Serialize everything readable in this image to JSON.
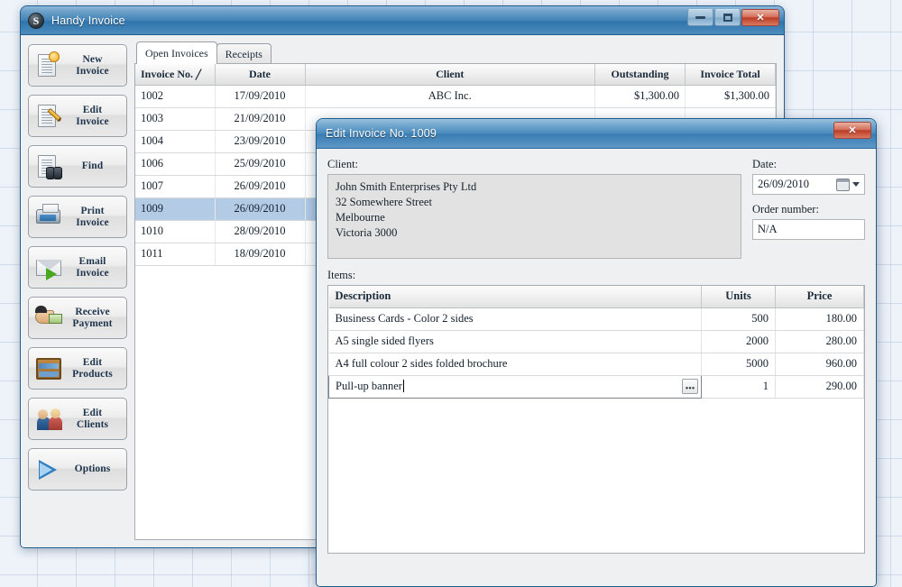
{
  "main_window": {
    "title": "Handy Invoice",
    "app_icon": "handy-invoice-logo-icon",
    "buttons": {
      "minimize": "–",
      "maximize": "□",
      "close": "✕"
    },
    "sidebar": [
      {
        "label_line1": "New",
        "label_line2": "Invoice",
        "icon": "new-invoice-icon"
      },
      {
        "label_line1": "Edit",
        "label_line2": "Invoice",
        "icon": "edit-invoice-icon"
      },
      {
        "label_line1": "Find",
        "label_line2": "",
        "icon": "find-icon"
      },
      {
        "label_line1": "Print",
        "label_line2": "Invoice",
        "icon": "print-invoice-icon"
      },
      {
        "label_line1": "Email",
        "label_line2": "Invoice",
        "icon": "email-invoice-icon"
      },
      {
        "label_line1": "Receive",
        "label_line2": "Payment",
        "icon": "receive-payment-icon"
      },
      {
        "label_line1": "Edit",
        "label_line2": "Products",
        "icon": "edit-products-icon"
      },
      {
        "label_line1": "Edit",
        "label_line2": "Clients",
        "icon": "edit-clients-icon"
      },
      {
        "label_line1": "Options",
        "label_line2": "",
        "icon": "options-icon"
      }
    ],
    "tabs": [
      {
        "label": "Open Invoices",
        "active": true
      },
      {
        "label": "Receipts",
        "active": false
      }
    ],
    "invoice_table": {
      "columns": [
        "Invoice No.",
        "Date",
        "Client",
        "Outstanding",
        "Invoice Total"
      ],
      "sort_indicator": "╱",
      "rows": [
        {
          "no": "1002",
          "date": "17/09/2010",
          "client": "ABC Inc.",
          "outstanding": "$1,300.00",
          "total": "$1,300.00",
          "selected": false
        },
        {
          "no": "1003",
          "date": "21/09/2010",
          "client": "",
          "outstanding": "",
          "total": "",
          "selected": false
        },
        {
          "no": "1004",
          "date": "23/09/2010",
          "client": "",
          "outstanding": "",
          "total": "",
          "selected": false
        },
        {
          "no": "1006",
          "date": "25/09/2010",
          "client": "",
          "outstanding": "",
          "total": "",
          "selected": false
        },
        {
          "no": "1007",
          "date": "26/09/2010",
          "client": "",
          "outstanding": "",
          "total": "",
          "selected": false
        },
        {
          "no": "1009",
          "date": "26/09/2010",
          "client": "",
          "outstanding": "",
          "total": "",
          "selected": true
        },
        {
          "no": "1010",
          "date": "28/09/2010",
          "client": "",
          "outstanding": "",
          "total": "",
          "selected": false
        },
        {
          "no": "1011",
          "date": "18/09/2010",
          "client": "",
          "outstanding": "",
          "total": "",
          "selected": false
        }
      ]
    }
  },
  "dialog": {
    "title": "Edit Invoice No. 1009",
    "close_label": "✕",
    "client_label": "Client:",
    "client_address": "John Smith Enterprises Pty Ltd\n32 Somewhere Street\nMelbourne\nVictoria  3000",
    "client_lines": [
      "John Smith Enterprises Pty Ltd",
      "32 Somewhere Street",
      "Melbourne",
      "Victoria  3000"
    ],
    "date_label": "Date:",
    "date_value": "26/09/2010",
    "date_picker_icon": "calendar-icon",
    "order_label": "Order number:",
    "order_value": "N/A",
    "items_label": "Items:",
    "items_table": {
      "columns": [
        "Description",
        "Units",
        "Price"
      ],
      "rows": [
        {
          "description": "Business Cards - Color 2 sides",
          "units": "500",
          "price": "180.00",
          "editing": false
        },
        {
          "description": "A5 single sided flyers",
          "units": "2000",
          "price": "280.00",
          "editing": false
        },
        {
          "description": "A4 full colour 2 sides folded brochure",
          "units": "5000",
          "price": "960.00",
          "editing": false
        },
        {
          "description": "Pull-up banner",
          "units": "1",
          "price": "290.00",
          "editing": true
        }
      ],
      "ellipsis_button_label": "•••"
    }
  },
  "colors": {
    "titlebar_blue": "#3a7db3",
    "close_red": "#bc3c25",
    "selection_blue": "#b4cbe6",
    "desktop_bg": "#eef3fa"
  }
}
